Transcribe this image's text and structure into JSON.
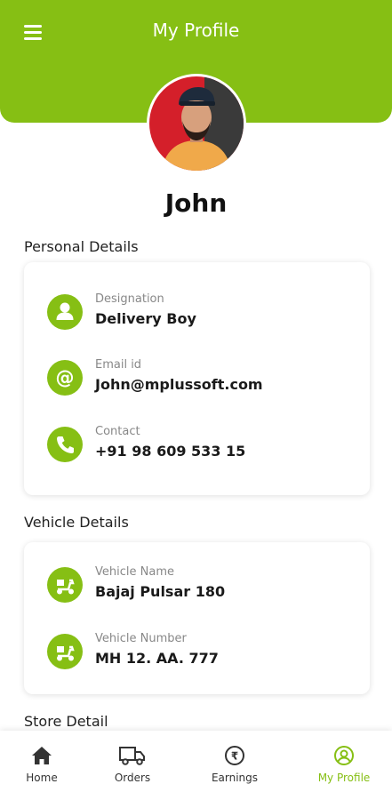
{
  "header": {
    "title": "My Profile"
  },
  "profile": {
    "name": "John"
  },
  "sections": {
    "personal": {
      "title": "Personal Details",
      "items": [
        {
          "label": "Designation",
          "value": "Delivery Boy",
          "icon": "person-icon"
        },
        {
          "label": "Email id",
          "value": "John@mplussoft.com",
          "icon": "at-sign-icon"
        },
        {
          "label": "Contact",
          "value": "+91 98 609 533 15",
          "icon": "phone-icon"
        }
      ]
    },
    "vehicle": {
      "title": "Vehicle Details",
      "items": [
        {
          "label": "Vehicle Name",
          "value": "Bajaj Pulsar 180",
          "icon": "scooter-icon"
        },
        {
          "label": "Vehicle Number",
          "value": "MH 12. AA. 777",
          "icon": "scooter-icon"
        }
      ]
    },
    "store": {
      "title": "Store Detail"
    }
  },
  "nav": {
    "items": [
      {
        "label": "Home",
        "icon": "home-icon"
      },
      {
        "label": "Orders",
        "icon": "truck-icon"
      },
      {
        "label": "Earnings",
        "icon": "rupee-icon"
      },
      {
        "label": "My Profile",
        "icon": "user-circle-icon"
      }
    ],
    "active": "My Profile"
  },
  "colors": {
    "accent": "#86bf14",
    "text": "#1c1c1c",
    "muted": "#888888"
  }
}
